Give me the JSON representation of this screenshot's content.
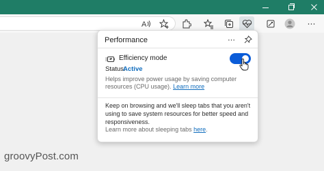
{
  "titlebar": {
    "minimize_label": "Minimize",
    "maximize_label": "Restore",
    "close_label": "Close"
  },
  "toolbar": {
    "icons": [
      "read-aloud-icon",
      "add-favorite-icon",
      "extensions-icon",
      "favorites-icon",
      "collections-icon",
      "performance-heart-icon",
      "screenshot-icon",
      "profile-avatar"
    ]
  },
  "performance": {
    "title": "Performance",
    "more_glyph": "⋯",
    "efficiency_label": "Efficiency mode",
    "efficiency_on": true,
    "status_label": "Status:",
    "status_value": "Active",
    "help_text": "Helps improve power usage by saving computer resources (CPU usage).",
    "help_link": "Learn more",
    "sleeping_text": "Keep on browsing and we'll sleep tabs that you aren't using to save system resources for better speed and responsiveness.",
    "sleeping_learn_prefix": "Learn more about sleeping tabs",
    "sleeping_learn_link": "here",
    "sleeping_learn_suffix": "."
  },
  "watermark": "groovyPost.com",
  "colors": {
    "titlebar": "#1f7d66",
    "toggle": "#0b5cd8",
    "link": "#0f6cbd"
  }
}
